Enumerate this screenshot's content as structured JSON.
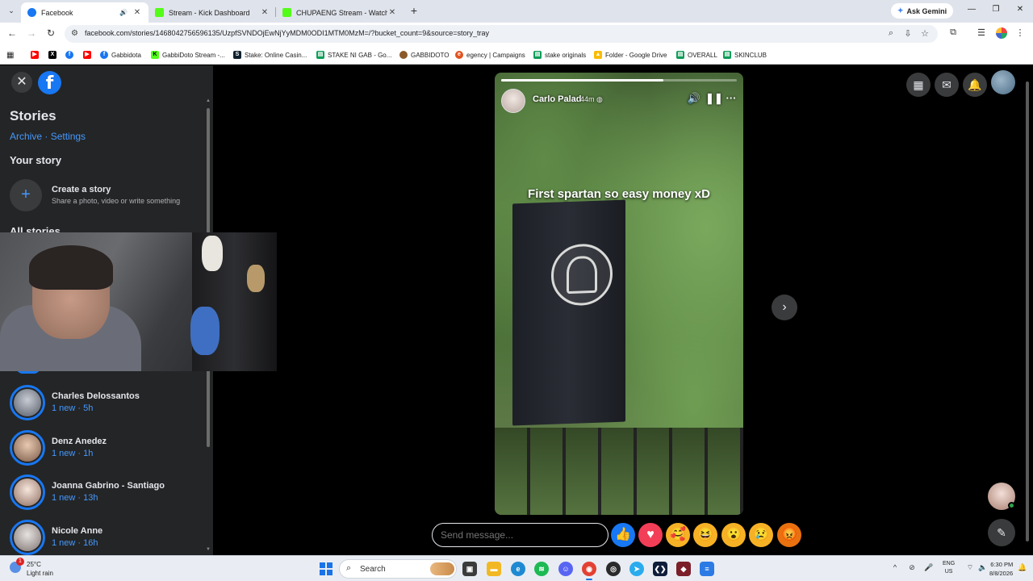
{
  "browser": {
    "tabs": [
      {
        "title": "Facebook",
        "active": true,
        "icon": "facebook-favicon",
        "color": "#1877f2"
      },
      {
        "title": "Stream - Kick Dashboard",
        "active": false,
        "icon": "kick-favicon",
        "color": "#53fc18"
      },
      {
        "title": "CHUPAENG Stream - Watch Live",
        "active": false,
        "icon": "kick-favicon",
        "color": "#53fc18"
      }
    ],
    "ask_gemini": "Ask Gemini",
    "url": "facebook.com/stories/1468042756596135/UzpfSVNDOjEwNjYyMDM0ODI1MTM0MzM=/?bucket_count=9&source=story_tray",
    "bookmarks": [
      {
        "label": "",
        "icon": "youtube-icon",
        "color": "#ff0000"
      },
      {
        "label": "",
        "icon": "x-icon",
        "color": "#000000"
      },
      {
        "label": "",
        "icon": "facebook-icon",
        "color": "#1877f2"
      },
      {
        "label": "Gabbidota",
        "icon": "facebook-icon",
        "color": "#1877f2"
      },
      {
        "label": "GabbiDoto Stream -...",
        "icon": "kick-icon",
        "color": "#53fc18"
      },
      {
        "label": "Stake: Online Casin...",
        "icon": "stake-icon",
        "color": "#0f212e"
      },
      {
        "label": "STAKE NI GAB - Go...",
        "icon": "sheets-icon",
        "color": "#0f9d58"
      },
      {
        "label": "GABBIDOTO",
        "icon": "channel-icon",
        "color": "#8b5a2b"
      },
      {
        "label": "egency | Campaigns",
        "icon": "egency-icon",
        "color": "#e2531f"
      },
      {
        "label": "stake originals",
        "icon": "sheets-icon",
        "color": "#0f9d58"
      },
      {
        "label": "Folder - Google Drive",
        "icon": "drive-icon",
        "color": "#fbbc04"
      },
      {
        "label": "OVERALL",
        "icon": "sheets-icon",
        "color": "#0f9d58"
      },
      {
        "label": "SKINCLUB",
        "icon": "sheets-icon",
        "color": "#0f9d58"
      }
    ]
  },
  "sidebar": {
    "title": "Stories",
    "archive_link": "Archive",
    "separator": " · ",
    "settings_link": "Settings",
    "your_story_heading": "Your story",
    "create_title": "Create a story",
    "create_subtitle": "Share a photo, video or write something",
    "all_stories_heading": "All stories",
    "stories": [
      {
        "name": "Charles Delossantos",
        "meta": "1 new · 5h"
      },
      {
        "name": "Denz Anedez",
        "meta": "1 new · 1h"
      },
      {
        "name": "Joanna Gabrino - Santiago",
        "meta": "1 new · 13h"
      },
      {
        "name": "Nicole Anne",
        "meta": "1 new · 16h"
      }
    ]
  },
  "story": {
    "poster_name": "Carlo Palad",
    "time": "44m",
    "caption": "First spartan so easy money xD",
    "progress": 0.69
  },
  "message_placeholder": "Send message...",
  "reactions": [
    {
      "icon": "like-icon",
      "glyph": "👍",
      "color": "#1877f2"
    },
    {
      "icon": "love-icon",
      "glyph": "❤",
      "color": "#f33e58"
    },
    {
      "icon": "care-icon",
      "glyph": "🥰",
      "color": "#f7b125"
    },
    {
      "icon": "haha-icon",
      "glyph": "😆",
      "color": "#f7b125"
    },
    {
      "icon": "wow-icon",
      "glyph": "😮",
      "color": "#f7b125"
    },
    {
      "icon": "sad-icon",
      "glyph": "😢",
      "color": "#f7b125"
    },
    {
      "icon": "angry-icon",
      "glyph": "😡",
      "color": "#e9710f"
    }
  ],
  "taskbar": {
    "weather_temp": "25°C",
    "weather_cond": "Light rain",
    "weather_badge": "1",
    "search_label": "Search",
    "lang_line1": "ENG",
    "lang_line2": "US",
    "time": "6:30 PM",
    "date": "8/8/2026"
  }
}
